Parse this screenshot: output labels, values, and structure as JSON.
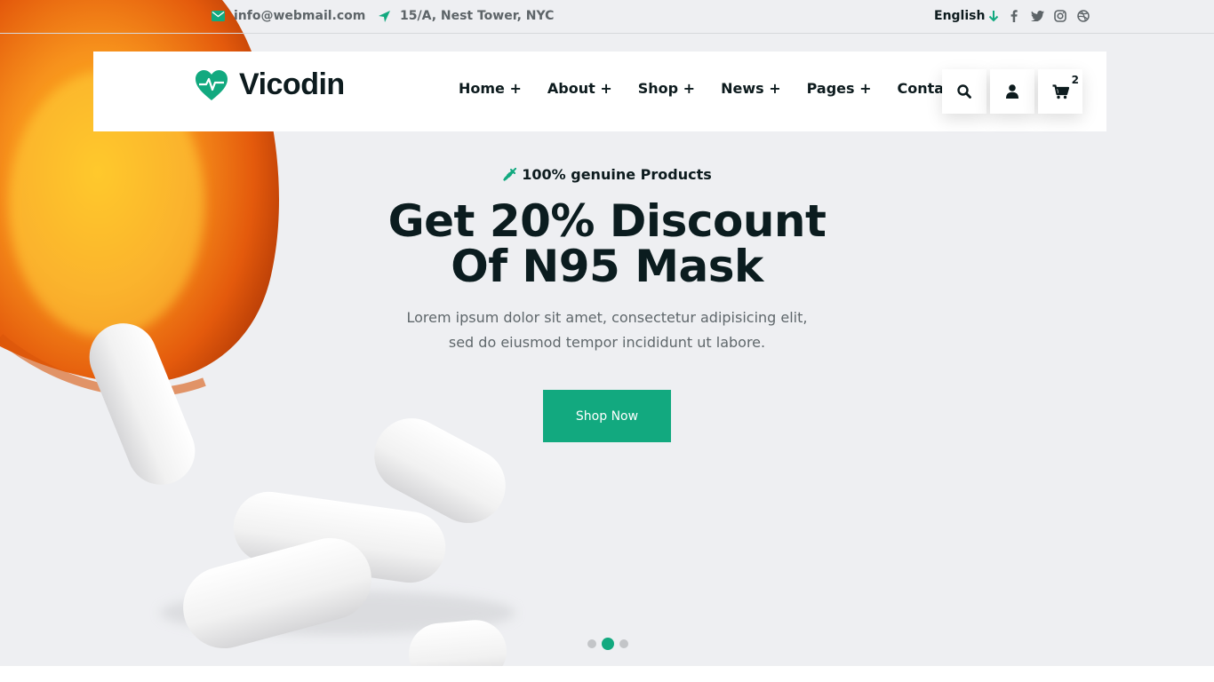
{
  "topbar": {
    "email": "info@webmail.com",
    "address": "15/A, Nest Tower, NYC",
    "language": "English",
    "socials": [
      "facebook-icon",
      "twitter-icon",
      "instagram-icon",
      "dribbble-icon"
    ]
  },
  "header": {
    "logo_text": "Vicodin",
    "nav": [
      "Home +",
      "About +",
      "Shop +",
      "News +",
      "Pages +",
      "Contact"
    ],
    "cart_count": "2"
  },
  "hero": {
    "tagline": "100% genuine Products",
    "headline_line1": "Get 20% Discount",
    "headline_line2": "Of N95 Mask",
    "description_line1": "Lorem ipsum dolor sit amet, consectetur adipisicing elit,",
    "description_line2": "sed do eiusmod tempor incididunt ut labore.",
    "button_label": "Shop Now",
    "slides_total": 3,
    "active_slide": 2
  },
  "colors": {
    "accent": "#12a97f",
    "dark_text": "#0d1b1e",
    "muted_text": "#5f676b",
    "hero_background": "#eeeff2"
  }
}
